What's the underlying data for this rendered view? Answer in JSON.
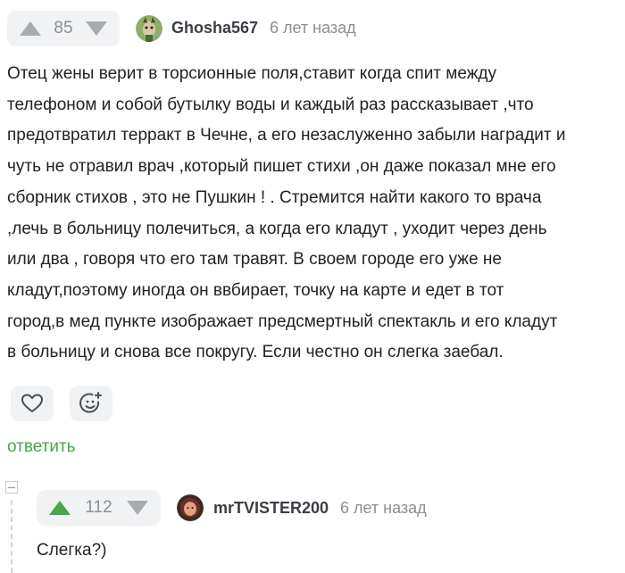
{
  "comment": {
    "rating": "85",
    "author": "Ghosha567",
    "time": "6 лет назад",
    "lines": [
      "Отец жены верит в торсионные поля,ставит когда спит между",
      "телефоном и собой бутылку воды и каждый раз рассказывает ,что",
      "предотвратил терракт в Чечне, а его незаслуженно забыли наградит и",
      "чуть не отравил врач ,который пишет стихи ,он даже показал мне его",
      "сборник стихов , это не Пушкин ! . Стремится найти какого то врача",
      ",лечь в больницу полечиться, а когда его кладут , уходит через день",
      "или два , говоря что его там травят. В своем городе его уже не",
      "кладут,поэтому иногда он ввбирает, точку на карте и едет в тот",
      "город,в мед пункте изображает предсмертный спектакль и его кладут",
      "в больницу и снова все покругу. Если честно он слегка заебал."
    ],
    "reply_label": "ответить"
  },
  "reply": {
    "rating": "112",
    "author": "mrTVISTER200",
    "time": "6 лет назад",
    "text": "Слегка?)"
  },
  "icons": {
    "upvote": "arrow-up-icon",
    "downvote": "arrow-down-icon",
    "like": "heart-icon",
    "reaction": "smile-plus-icon",
    "collapse": "minus-icon"
  },
  "colors": {
    "accent_green": "#46a64b",
    "pill_bg": "#f1f2f4",
    "muted": "#8a8f96"
  }
}
